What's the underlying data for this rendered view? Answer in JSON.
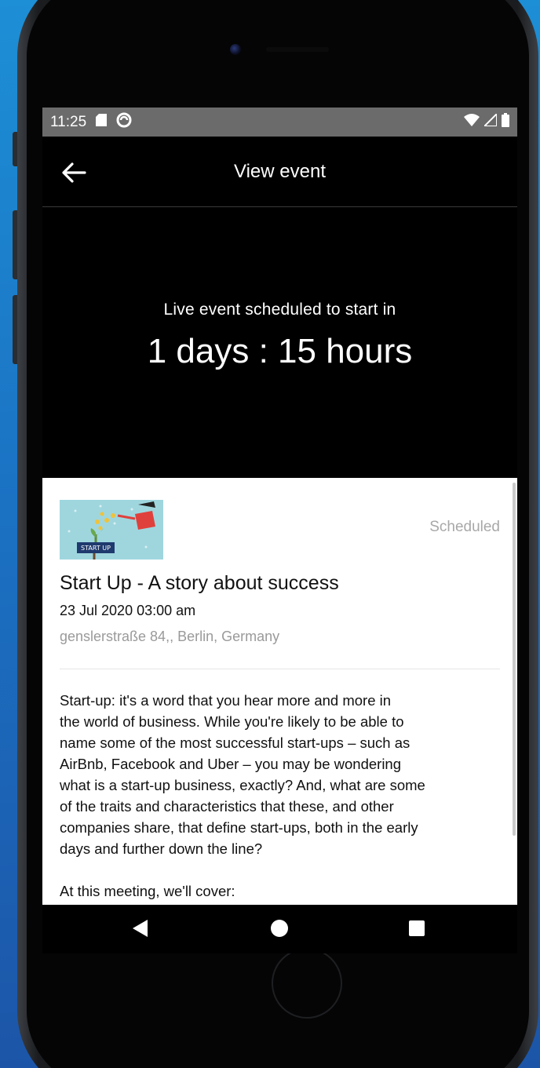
{
  "status_bar": {
    "time": "11:25",
    "left_icons": [
      "sd-card-icon",
      "sync-icon"
    ],
    "right_icons": [
      "wifi-icon",
      "signal-icon",
      "battery-icon"
    ]
  },
  "header": {
    "title": "View event",
    "back_icon": "arrow-left-icon"
  },
  "countdown": {
    "label": "Live event scheduled to start in",
    "value": "1 days : 15 hours"
  },
  "event": {
    "thumbnail_text": "START UP",
    "status": "Scheduled",
    "title": "Start Up - A story about success",
    "datetime": "23 Jul 2020 03:00 am",
    "location": "genslerstraße 84,, Berlin, Germany",
    "description_lines": [
      "Start-up: it's a word that you hear more and more in",
      "the world of business. While you're likely to be able to",
      "name some of the most successful start-ups – such as",
      "AirBnb, Facebook and Uber – you may be wondering",
      "what is a start-up business, exactly? And, what are some",
      "of the traits and characteristics that these, and other",
      "companies share, that define start-ups, both in the early",
      "days and further down the line?"
    ],
    "description_p2": "At this meeting, we'll cover:"
  },
  "navigation": {
    "icons": [
      "nav-back-icon",
      "nav-home-icon",
      "nav-recents-icon"
    ]
  },
  "colors": {
    "background_blue": "#1b73c4",
    "status_bar": "#6b6b6b",
    "screen_bg": "#000000",
    "card_bg": "#ffffff",
    "status_text": "#a8a8a8"
  }
}
